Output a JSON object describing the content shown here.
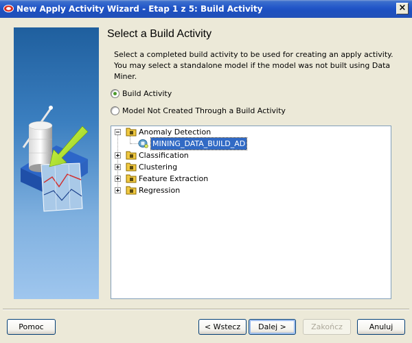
{
  "window": {
    "title": "New Apply Activity Wizard - Etap 1 z 5: Build Activity",
    "close_glyph": "×",
    "icon": "oracle-data-miner-icon"
  },
  "page": {
    "heading": "Select a Build Activity",
    "description": "Select a completed build activity to be used for creating an apply activity.  You may select a standalone model if the model was not built using Data Miner."
  },
  "options": {
    "build_activity": {
      "label": "Build Activity",
      "checked": true
    },
    "model_not_created": {
      "label": "Model Not Created Through a Build Activity",
      "checked": false
    }
  },
  "tree": {
    "items": [
      {
        "label": "Anomaly Detection",
        "expanded": true
      },
      {
        "label": "MINING_DATA_BUILD_AD",
        "selected": true,
        "icon": "model-icon"
      },
      {
        "label": "Classification",
        "expanded": false
      },
      {
        "label": "Clustering",
        "expanded": false
      },
      {
        "label": "Feature Extraction",
        "expanded": false
      },
      {
        "label": "Regression",
        "expanded": false
      }
    ]
  },
  "buttons": {
    "help": "Pomoc",
    "back": "< Wstecz",
    "next": "Dalej >",
    "finish": "Zakończ",
    "cancel": "Anuluj"
  },
  "colors": {
    "titlebar": "#2458c9",
    "selection": "#316ac5",
    "radio_check": "#4c9a2a"
  }
}
